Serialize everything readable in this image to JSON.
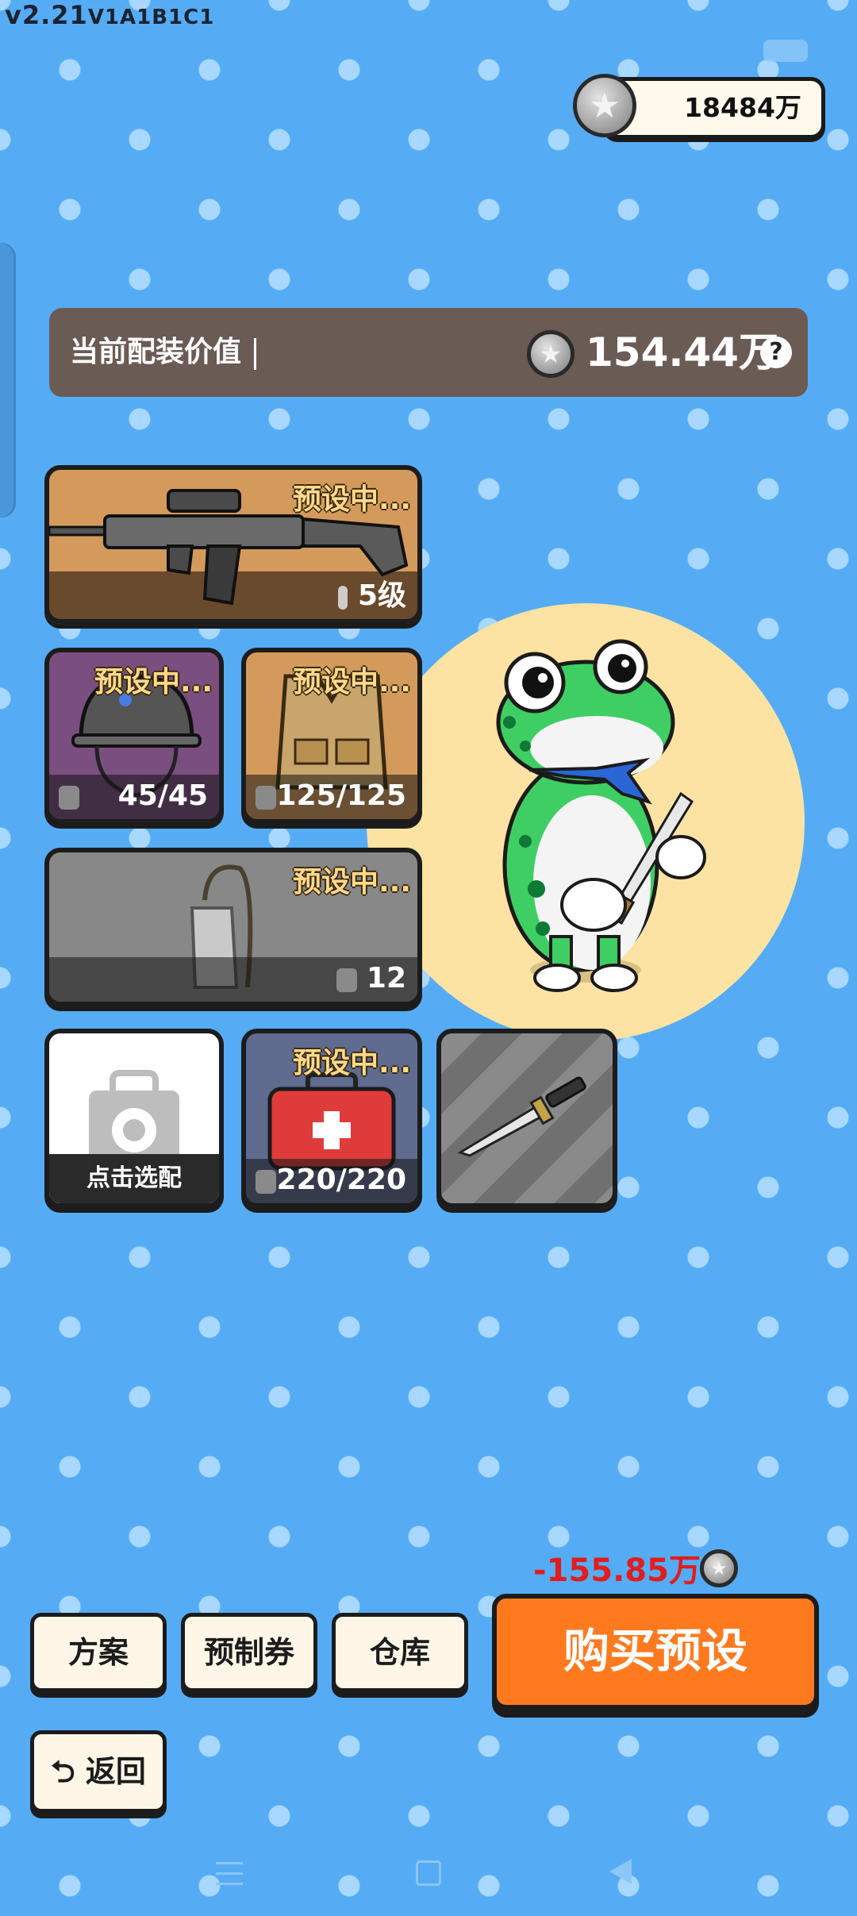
{
  "version": {
    "main": "v2.21",
    "sub": "V1A1B1C1"
  },
  "wallet": {
    "amount": "18484万"
  },
  "loadout": {
    "label": "当前配装价值",
    "value": "154.44万",
    "help": "?"
  },
  "slots": {
    "weapon": {
      "preset": "预设中...",
      "stat": "5级"
    },
    "helmet": {
      "preset": "预设中...",
      "stat": "45/45"
    },
    "vest": {
      "preset": "预设中...",
      "stat": "125/125"
    },
    "bag": {
      "preset": "预设中...",
      "stat": "12"
    },
    "empty": {
      "label": "点击选配"
    },
    "medkit": {
      "preset": "预设中...",
      "stat": "220/220"
    }
  },
  "cost": {
    "amount": "-155.85万"
  },
  "buttons": {
    "scheme": "方案",
    "voucher": "预制券",
    "warehouse": "仓库",
    "buy": "购买预设",
    "back": "返回",
    "back_icon": "⮌"
  },
  "colors": {
    "background": "#55acf5",
    "buy_button": "#ff7a1f",
    "cost_text": "#e11d1d",
    "preset_text": "#ffd98a"
  },
  "icons": [
    "star-coin-icon",
    "rifle-icon",
    "helmet-icon",
    "vest-icon",
    "backpack-icon",
    "toolbox-icon",
    "medkit-icon",
    "knife-icon",
    "frog-character",
    "help-icon"
  ]
}
